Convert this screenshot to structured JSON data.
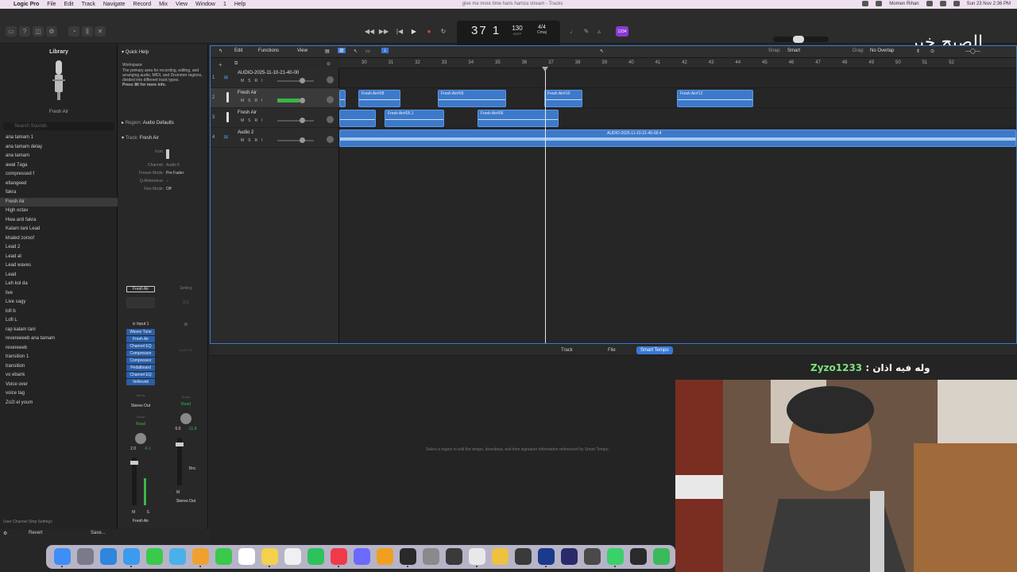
{
  "menubar": {
    "app": "Logic Pro",
    "items": [
      "File",
      "Edit",
      "Track",
      "Navigate",
      "Record",
      "Mix",
      "View",
      "Window",
      "1",
      "Help"
    ],
    "window_title": "give me more time haris hamza stream - Tracks",
    "user": "Momen Rihan",
    "datetime": "Sun 23 Nov 2:36 PM"
  },
  "transport": {
    "position_bar": "37",
    "position_beat": "1",
    "tempo": "130",
    "tempo_sub": "KEEP",
    "time_signature": "4/4",
    "key": "Cmaj",
    "count_in": "1234"
  },
  "overlay_arabic_title": "الصبح خير",
  "library": {
    "title": "Library",
    "preset_name": "Fresh Air",
    "search_placeholder": "Search Sounds",
    "items": [
      "ana tamam 1",
      "ana tamam delay",
      "ana tamam",
      "awal 7aga",
      "compressed f",
      "eltangeed",
      "fakra",
      "Fresh Air",
      "High octav",
      "Hwa anti fakra",
      "Kalam tani Lead",
      "khaled zoroof",
      "Lead 2",
      "Lead at",
      "Lead waves",
      "Lead",
      "Leh kol da",
      "live",
      "Live sagy",
      "lofi b",
      "Lofi L",
      "rap kalam tani",
      "revereeeeb ana tamam",
      "revereeeb",
      "transition 1",
      "transition",
      "vo ebank",
      "Voice over",
      "voice tag",
      "Zo2l el youm"
    ],
    "selected_index": 7,
    "footer": "User Channel Strip Settings",
    "revert": "Revert",
    "save": "Save..."
  },
  "inspector": {
    "quick_help_title": "Quick Help",
    "quick_help_heading": "Workspace",
    "quick_help_text": "The primary area for recording, editing, and arranging audio, MIDI, and Drummer regions, divided into different track types.",
    "quick_help_more": "Press ⌘/ for more info.",
    "region_label": "Region:",
    "region_value": "Audio Defaults",
    "track_label": "Track:",
    "track_value": "Fresh Air",
    "rows": [
      {
        "k": "Icon:",
        "v": ""
      },
      {
        "k": "Channel:",
        "v": "Audio 5"
      },
      {
        "k": "Freeze Mode:",
        "v": "Pre Fader"
      },
      {
        "k": "Q-Reference:",
        "v": "✓"
      },
      {
        "k": "Flex Mode:",
        "v": "Off"
      }
    ],
    "strip1": {
      "setting": "Fresh Air",
      "input": "Input 1",
      "plugins": [
        "Waves Tune",
        "Fresh Air",
        "Channel EQ",
        "Compressor",
        "Compressor",
        "Pedalboard",
        "Channel EQ",
        "VeReveb"
      ],
      "sends": "Sends",
      "output": "Stereo Out",
      "group": "Group",
      "automation": "Read",
      "vol_a": "2.0",
      "vol_b": "-6.1",
      "name": "Fresh Air"
    },
    "strip2": {
      "setting": "Setting",
      "eq": "EQ",
      "audio_fx": "Audio FX",
      "group": "Group",
      "automation": "Read",
      "vol_a": "0.0",
      "vol_b": "-11.8",
      "bnc": "Bnc",
      "name": "Stereo Out"
    }
  },
  "tracks_toolbar": {
    "edit": "Edit",
    "functions": "Functions",
    "view": "View",
    "snap_label": "Snap:",
    "snap_value": "Smart",
    "drag_label": "Drag:",
    "drag_value": "No Overlap"
  },
  "ruler": [
    "30",
    "31",
    "32",
    "33",
    "34",
    "35",
    "36",
    "37",
    "38",
    "39",
    "40",
    "41",
    "42",
    "43",
    "44",
    "45",
    "46",
    "47",
    "48",
    "49",
    "50",
    "51",
    "52"
  ],
  "tracks": [
    {
      "num": "1",
      "name": "AUDIO-2025-11-10-21-40-00",
      "msri": "MSRI"
    },
    {
      "num": "2",
      "name": "Fresh Air",
      "msri": "MSRI"
    },
    {
      "num": "3",
      "name": "Fresh Air",
      "msri": "MSRI"
    },
    {
      "num": "4",
      "name": "Audio 2",
      "msri": "MSRI"
    }
  ],
  "regions": {
    "r2a": "Fresh Air#08",
    "r2b": "Fresh Air#09",
    "r2c": "Fresh Air#10",
    "r2d": "Fresh Air#12",
    "r3a": "Fresh Air#05.1",
    "r3b": "Fresh Air#06",
    "r4": "AUDIO-2025-11-10-21-40-00.4"
  },
  "bottom_tabs": [
    "Track",
    "File",
    "Smart Tempo"
  ],
  "bottom_active": 2,
  "editor_message": "Select a region to edit the tempo, downbeat, and time signature information referenced by Smart Tempo.",
  "chat": {
    "user": "Zyzo1233",
    "sep": " : ",
    "message": "وله فيه اذان"
  },
  "colors": {
    "region": "#3d79c9",
    "selection": "#3a78d6",
    "record": "#e0413a"
  }
}
